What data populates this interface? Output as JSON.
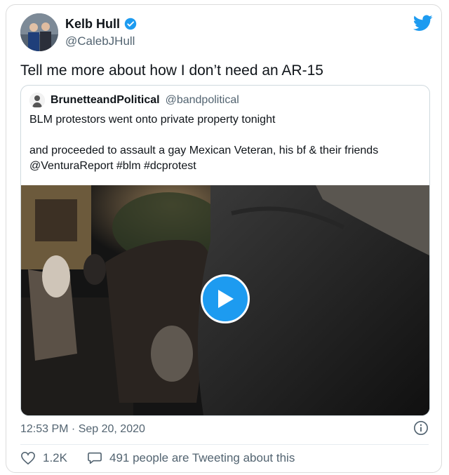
{
  "tweet": {
    "display_name": "Kelb Hull",
    "handle": "@CalebJHull",
    "text": "Tell me more about how I don’t need an AR-15",
    "timestamp": "12:53 PM · Sep 20, 2020"
  },
  "quoted": {
    "display_name": "BrunetteandPolitical",
    "handle": "@bandpolitical",
    "line1": "BLM protestors went onto private property tonight",
    "line2": "and proceeded to assault a gay Mexican Veteran, his bf & their friends @VenturaReport #blm #dcprotest"
  },
  "actions": {
    "likes": "1.2K",
    "tweeting_text": "491 people are Tweeting about this"
  },
  "colors": {
    "brand_blue": "#1d9bf0",
    "secondary_text": "#536471"
  },
  "icons": [
    "verified-badge-icon",
    "twitter-bird-icon",
    "play-icon",
    "info-icon",
    "heart-icon",
    "comment-icon"
  ]
}
